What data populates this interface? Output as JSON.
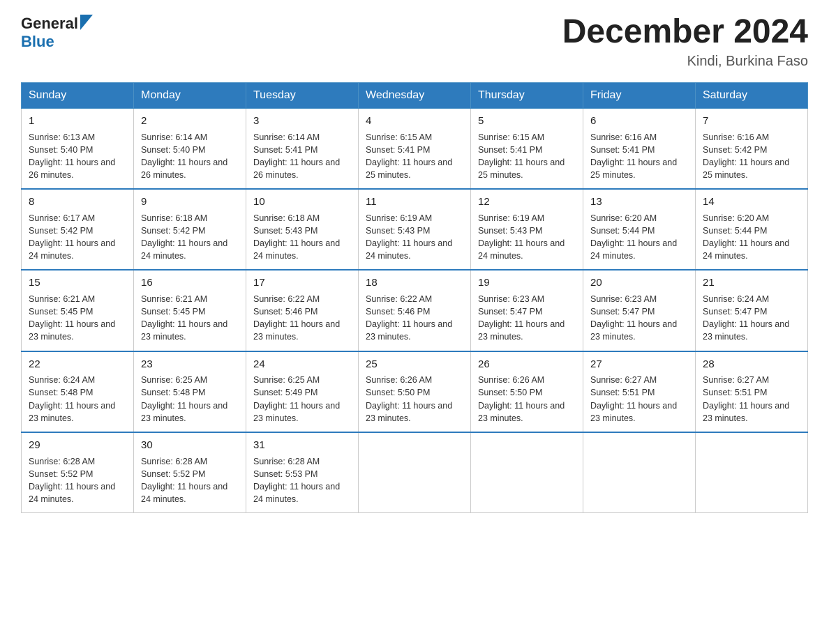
{
  "header": {
    "logo_general": "General",
    "logo_blue": "Blue",
    "month_title": "December 2024",
    "location": "Kindi, Burkina Faso"
  },
  "weekdays": [
    "Sunday",
    "Monday",
    "Tuesday",
    "Wednesday",
    "Thursday",
    "Friday",
    "Saturday"
  ],
  "weeks": [
    [
      {
        "day": "1",
        "sunrise": "6:13 AM",
        "sunset": "5:40 PM",
        "daylight": "11 hours and 26 minutes."
      },
      {
        "day": "2",
        "sunrise": "6:14 AM",
        "sunset": "5:40 PM",
        "daylight": "11 hours and 26 minutes."
      },
      {
        "day": "3",
        "sunrise": "6:14 AM",
        "sunset": "5:41 PM",
        "daylight": "11 hours and 26 minutes."
      },
      {
        "day": "4",
        "sunrise": "6:15 AM",
        "sunset": "5:41 PM",
        "daylight": "11 hours and 25 minutes."
      },
      {
        "day": "5",
        "sunrise": "6:15 AM",
        "sunset": "5:41 PM",
        "daylight": "11 hours and 25 minutes."
      },
      {
        "day": "6",
        "sunrise": "6:16 AM",
        "sunset": "5:41 PM",
        "daylight": "11 hours and 25 minutes."
      },
      {
        "day": "7",
        "sunrise": "6:16 AM",
        "sunset": "5:42 PM",
        "daylight": "11 hours and 25 minutes."
      }
    ],
    [
      {
        "day": "8",
        "sunrise": "6:17 AM",
        "sunset": "5:42 PM",
        "daylight": "11 hours and 24 minutes."
      },
      {
        "day": "9",
        "sunrise": "6:18 AM",
        "sunset": "5:42 PM",
        "daylight": "11 hours and 24 minutes."
      },
      {
        "day": "10",
        "sunrise": "6:18 AM",
        "sunset": "5:43 PM",
        "daylight": "11 hours and 24 minutes."
      },
      {
        "day": "11",
        "sunrise": "6:19 AM",
        "sunset": "5:43 PM",
        "daylight": "11 hours and 24 minutes."
      },
      {
        "day": "12",
        "sunrise": "6:19 AM",
        "sunset": "5:43 PM",
        "daylight": "11 hours and 24 minutes."
      },
      {
        "day": "13",
        "sunrise": "6:20 AM",
        "sunset": "5:44 PM",
        "daylight": "11 hours and 24 minutes."
      },
      {
        "day": "14",
        "sunrise": "6:20 AM",
        "sunset": "5:44 PM",
        "daylight": "11 hours and 24 minutes."
      }
    ],
    [
      {
        "day": "15",
        "sunrise": "6:21 AM",
        "sunset": "5:45 PM",
        "daylight": "11 hours and 23 minutes."
      },
      {
        "day": "16",
        "sunrise": "6:21 AM",
        "sunset": "5:45 PM",
        "daylight": "11 hours and 23 minutes."
      },
      {
        "day": "17",
        "sunrise": "6:22 AM",
        "sunset": "5:46 PM",
        "daylight": "11 hours and 23 minutes."
      },
      {
        "day": "18",
        "sunrise": "6:22 AM",
        "sunset": "5:46 PM",
        "daylight": "11 hours and 23 minutes."
      },
      {
        "day": "19",
        "sunrise": "6:23 AM",
        "sunset": "5:47 PM",
        "daylight": "11 hours and 23 minutes."
      },
      {
        "day": "20",
        "sunrise": "6:23 AM",
        "sunset": "5:47 PM",
        "daylight": "11 hours and 23 minutes."
      },
      {
        "day": "21",
        "sunrise": "6:24 AM",
        "sunset": "5:47 PM",
        "daylight": "11 hours and 23 minutes."
      }
    ],
    [
      {
        "day": "22",
        "sunrise": "6:24 AM",
        "sunset": "5:48 PM",
        "daylight": "11 hours and 23 minutes."
      },
      {
        "day": "23",
        "sunrise": "6:25 AM",
        "sunset": "5:48 PM",
        "daylight": "11 hours and 23 minutes."
      },
      {
        "day": "24",
        "sunrise": "6:25 AM",
        "sunset": "5:49 PM",
        "daylight": "11 hours and 23 minutes."
      },
      {
        "day": "25",
        "sunrise": "6:26 AM",
        "sunset": "5:50 PM",
        "daylight": "11 hours and 23 minutes."
      },
      {
        "day": "26",
        "sunrise": "6:26 AM",
        "sunset": "5:50 PM",
        "daylight": "11 hours and 23 minutes."
      },
      {
        "day": "27",
        "sunrise": "6:27 AM",
        "sunset": "5:51 PM",
        "daylight": "11 hours and 23 minutes."
      },
      {
        "day": "28",
        "sunrise": "6:27 AM",
        "sunset": "5:51 PM",
        "daylight": "11 hours and 23 minutes."
      }
    ],
    [
      {
        "day": "29",
        "sunrise": "6:28 AM",
        "sunset": "5:52 PM",
        "daylight": "11 hours and 24 minutes."
      },
      {
        "day": "30",
        "sunrise": "6:28 AM",
        "sunset": "5:52 PM",
        "daylight": "11 hours and 24 minutes."
      },
      {
        "day": "31",
        "sunrise": "6:28 AM",
        "sunset": "5:53 PM",
        "daylight": "11 hours and 24 minutes."
      },
      null,
      null,
      null,
      null
    ]
  ],
  "labels": {
    "sunrise": "Sunrise: ",
    "sunset": "Sunset: ",
    "daylight": "Daylight: "
  }
}
